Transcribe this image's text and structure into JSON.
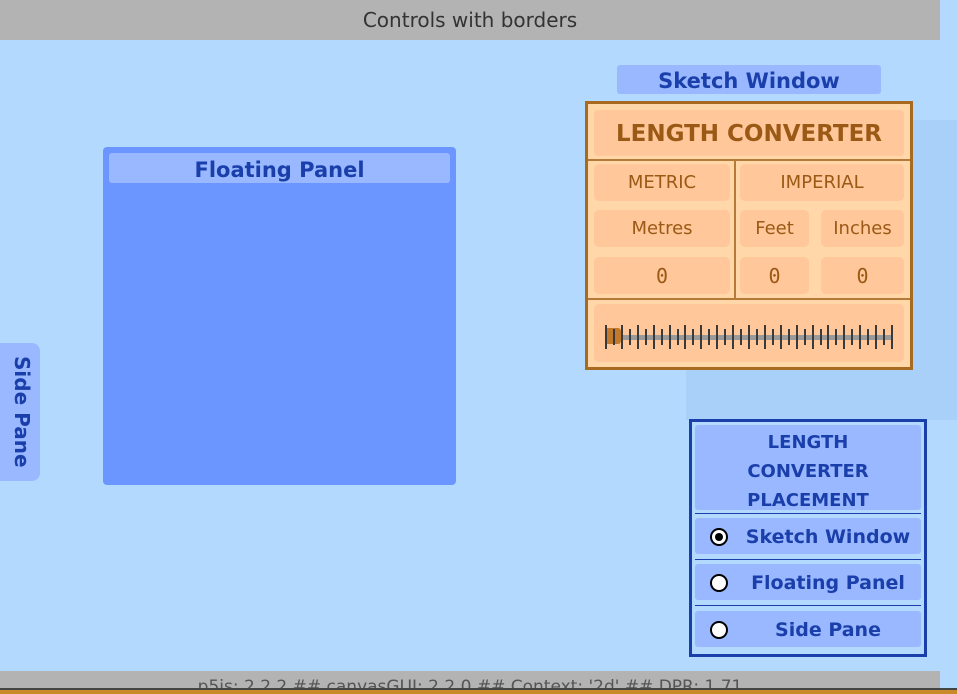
{
  "window": {
    "title": "Controls with borders"
  },
  "floating_panel": {
    "title": "Floating Panel"
  },
  "side_pane": {
    "label": "Side Pane"
  },
  "sketch_window": {
    "title": "Sketch Window"
  },
  "length_converter": {
    "title": "LENGTH CONVERTER",
    "metric_label": "METRIC",
    "imperial_label": "IMPERIAL",
    "units": {
      "metres": "Metres",
      "feet": "Feet",
      "inches": "Inches"
    },
    "values": {
      "metres": "0",
      "feet": "0",
      "inches": "0"
    },
    "slider": {
      "value": 0
    }
  },
  "placement": {
    "title_lines": [
      "LENGTH",
      "CONVERTER",
      "PLACEMENT"
    ],
    "options": [
      {
        "label": "Sketch Window",
        "selected": true
      },
      {
        "label": "Floating Panel",
        "selected": false
      },
      {
        "label": "Side Pane",
        "selected": false
      }
    ]
  },
  "status_bar": {
    "text": "p5js: 2.2.2   ##   canvasGUI: 2.2.0   ##   Context: '2d'   ##   DPR: 1.71"
  },
  "colors": {
    "background": "#b3d9ff",
    "panel": "#6b96ff",
    "converter": "#ffd7a8",
    "accent": "#1a3faa"
  }
}
